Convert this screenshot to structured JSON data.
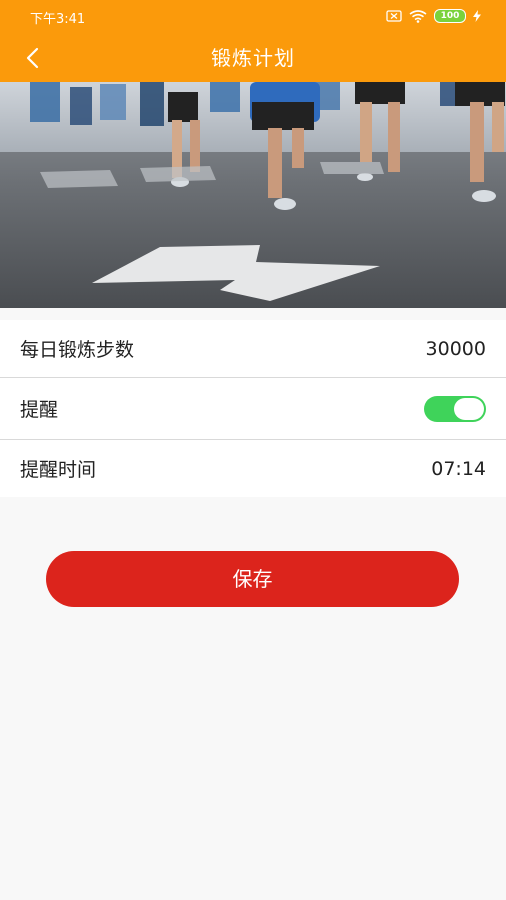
{
  "status_bar": {
    "time": "下午3:41",
    "battery": "100",
    "icons": [
      "sim-off-icon",
      "wifi-icon",
      "battery-icon",
      "charging-icon"
    ]
  },
  "header": {
    "title": "锻炼计划",
    "back_icon": "back-chevron-icon"
  },
  "banner": {
    "description_icon": "running-photo"
  },
  "settings": {
    "daily_steps": {
      "label": "每日锻炼步数",
      "value": "30000"
    },
    "reminder": {
      "label": "提醒",
      "enabled": true
    },
    "reminder_time": {
      "label": "提醒时间",
      "value": "07:14"
    }
  },
  "save_label": "保存",
  "colors": {
    "header": "#fb9a0b",
    "toggle_on": "#3fd35a",
    "save_button": "#dc241c"
  }
}
